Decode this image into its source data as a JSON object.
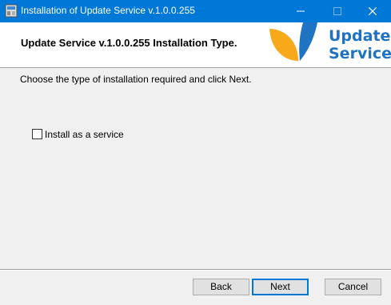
{
  "window": {
    "title": "Installation of Update Service v.1.0.0.255",
    "controls": [
      "minimize-icon",
      "maximize-icon",
      "close-icon"
    ]
  },
  "header": {
    "title": "Update Service v.1.0.0.255 Installation Type.",
    "logo_line1": "Update",
    "logo_line2": "Service",
    "logo_colors": {
      "orange": "#f7a81b",
      "blue": "#1f73c3"
    }
  },
  "content": {
    "instruction": "Choose the type of installation required and click Next.",
    "options": [
      {
        "label": "Install as a service",
        "checked": false
      }
    ]
  },
  "footer": {
    "back_label": "Back",
    "next_label": "Next",
    "cancel_label": "Cancel"
  },
  "colors": {
    "titlebar": "#0078d7",
    "background": "#f0f0f0",
    "accent": "#1f73c3"
  }
}
